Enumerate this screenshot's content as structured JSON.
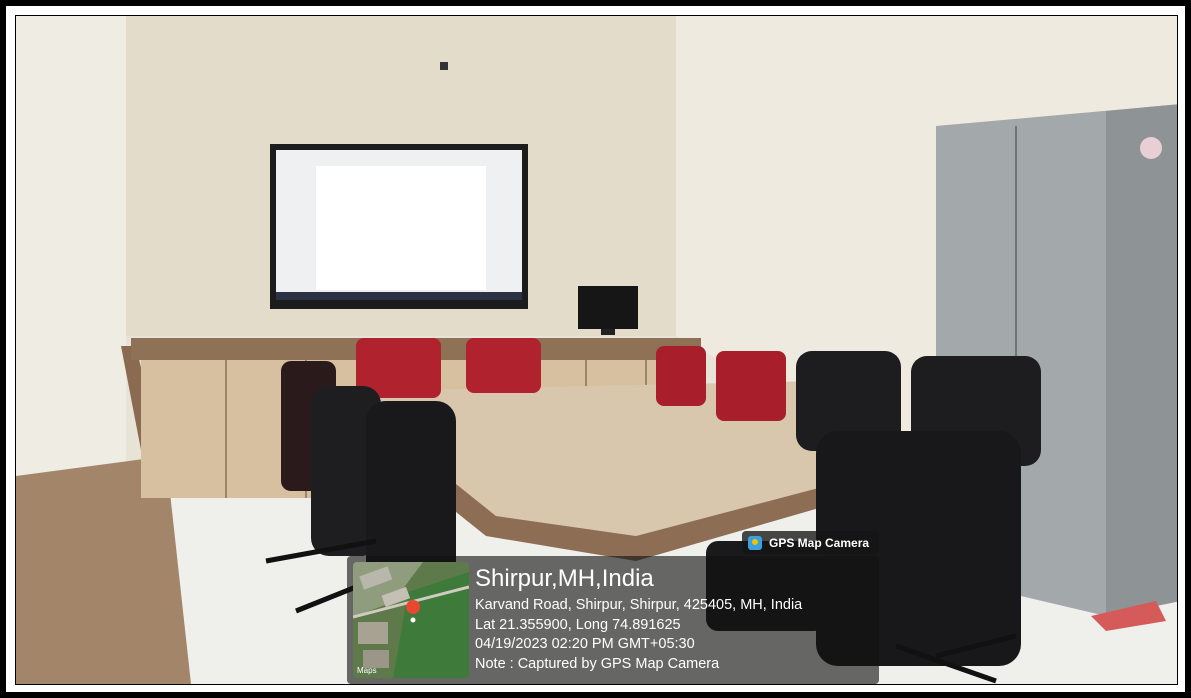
{
  "overlay": {
    "app_label": "GPS Map Camera",
    "app_icon": "gps-map-camera-icon",
    "map_attribution": "Maps",
    "place": "Shirpur,MH,India",
    "address": "Karvand Road, Shirpur, Shirpur, 425405, MH, India",
    "coordinates": "Lat 21.355900, Long 74.891625",
    "datetime": "04/19/2023 02:20 PM GMT+05:30",
    "note": "Note : Captured by GPS Map Camera"
  },
  "colors": {
    "wall": "#e6e1d2",
    "cabinet": "#d8c3a5",
    "table": "#d9c7ad",
    "red_chair": "#b0222e",
    "black_chair": "#1d1d1f",
    "almirah": "#a4a9aa"
  }
}
